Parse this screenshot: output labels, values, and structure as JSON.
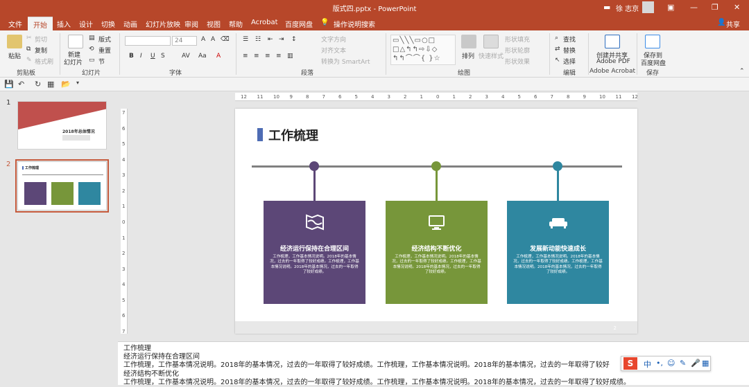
{
  "window": {
    "title": "版式四.pptx - PowerPoint",
    "user": "徐 志京",
    "share": "共享",
    "titlebar_color": "#b7472a"
  },
  "tabs": [
    "文件",
    "开始",
    "插入",
    "设计",
    "切换",
    "动画",
    "幻灯片放映",
    "审阅",
    "视图",
    "帮助",
    "Acrobat",
    "百度网盘"
  ],
  "tell_me": "操作说明搜索",
  "ribbon": {
    "clipboard": {
      "paste": "粘贴",
      "cut": "剪切",
      "copy": "复制",
      "format_painter": "格式刷",
      "label": "剪贴板"
    },
    "slides": {
      "new_slide_1": "新建",
      "new_slide_2": "幻灯片",
      "layout": "版式",
      "reset": "重置",
      "section": "节",
      "label": "幻灯片"
    },
    "font": {
      "font_size": "24",
      "label": "字体",
      "bold": "B",
      "italic": "I",
      "underline": "U",
      "shadow": "S",
      "spacing": "AV",
      "case": "Aa",
      "color_a": "A"
    },
    "paragraph": {
      "text_direction": "文字方向",
      "align_text": "对齐文本",
      "convert_smartart": "转换为 SmartArt",
      "label": "段落"
    },
    "drawing": {
      "arrange": "排列",
      "quick_styles": "快速样式",
      "shape_fill": "形状填充",
      "shape_outline": "形状轮廓",
      "shape_effects": "形状效果",
      "label": "绘图"
    },
    "editing": {
      "find": "查找",
      "replace": "替换",
      "select": "选择",
      "label": "编辑"
    },
    "acrobat": {
      "create_1": "创建并共享",
      "create_2": "Adobe PDF",
      "label": "Adobe Acrobat"
    },
    "save": {
      "save_1": "保存到",
      "save_2": "百度网盘",
      "label": "保存"
    }
  },
  "thumbnails": [
    {
      "num": "1",
      "title": "2018年总体情况"
    },
    {
      "num": "2",
      "title": "工作梳理"
    }
  ],
  "ruler_h": [
    "12",
    "11",
    "10",
    "9",
    "8",
    "7",
    "6",
    "5",
    "4",
    "3",
    "2",
    "1",
    "0",
    "1",
    "2",
    "3",
    "4",
    "5",
    "6",
    "7",
    "8",
    "9",
    "10",
    "11",
    "12"
  ],
  "ruler_v": [
    "7",
    "6",
    "5",
    "4",
    "3",
    "2",
    "1",
    "0",
    "1",
    "2",
    "3",
    "4",
    "5",
    "6",
    "7"
  ],
  "slide": {
    "title": "工作梳理",
    "page": "2",
    "cards": [
      {
        "title": "经济运行保持在合理区间",
        "body": "工作梳理，工作基本情况说明。2018年的基本情况，过去的一年取得了较好成绩。工作梳理，工作基本情况说明。2018年的基本情况，过去的一年取得了较好成绩。",
        "color": "#5c4777",
        "icon": "map-icon"
      },
      {
        "title": "经济结构不断优化",
        "body": "工作梳理，工作基本情况说明。2018年的基本情况，过去的一年取得了较好成绩。工作梳理，工作基本情况说明。2018年的基本情况，过去的一年取得了较好成绩。",
        "color": "#77963a",
        "icon": "monitor-icon"
      },
      {
        "title": "发展新动能快速成长",
        "body": "工作梳理，工作基本情况说明。2018年的基本情况，过去的一年取得了较好成绩。工作梳理，工作基本情况说明。2018年的基本情况，过去的一年取得了较好成绩。",
        "color": "#2f87a0",
        "icon": "sofa-icon"
      }
    ]
  },
  "notes": [
    "工作梳理",
    "经济运行保持在合理区间",
    "工作梳理，工作基本情况说明。2018年的基本情况，过去的一年取得了较好成绩。工作梳理，工作基本情况说明。2018年的基本情况，过去的一年取得了较好",
    "经济结构不断优化",
    "工作梳理，工作基本情况说明。2018年的基本情况，过去的一年取得了较好成绩。工作梳理，工作基本情况说明。2018年的基本情况，过去的一年取得了较好成绩。"
  ],
  "ime": {
    "lang": "中"
  }
}
